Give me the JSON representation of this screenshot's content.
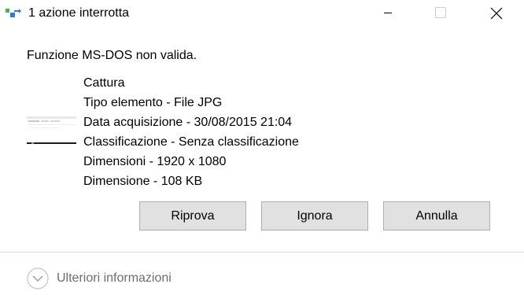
{
  "window": {
    "title": "1 azione interrotta"
  },
  "dialog": {
    "message": "Funzione MS-DOS non valida.",
    "file": {
      "name": "Cattura",
      "type": "Tipo elemento - File JPG",
      "date": "Data acquisizione - 30/08/2015 21:04",
      "rating": "Classificazione - Senza classificazione",
      "dimensions": "Dimensioni - 1920 x 1080",
      "size": "Dimensione - 108 KB"
    },
    "buttons": {
      "retry": "Riprova",
      "ignore": "Ignora",
      "cancel": "Annulla"
    },
    "more_info": "Ulteriori informazioni"
  },
  "icons": {
    "app": "file-copy-icon",
    "minimize": "minimize-icon",
    "maximize": "maximize-icon",
    "close": "close-icon",
    "more": "chevron-down-circle-icon"
  },
  "colors": {
    "button_bg": "#e1e1e1",
    "button_border": "#adadad",
    "muted_text": "#6d6d6d",
    "divider": "#dcdcdc"
  }
}
